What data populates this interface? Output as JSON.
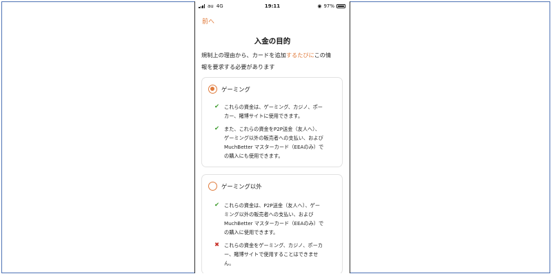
{
  "status": {
    "carrier": "au",
    "network": "4G",
    "time": "19:11",
    "battery": "97%"
  },
  "nav": {
    "back_label": "前へ"
  },
  "title": "入金の目的",
  "intro": {
    "line1_prefix": "規制上の理由から、カードを追加",
    "line1_highlight": "するたびに",
    "line1_suffix": "この情",
    "line2": "報を要求する必要があります"
  },
  "options": [
    {
      "label": "ゲーミング",
      "selected": true,
      "items": [
        {
          "ok": true,
          "lines": [
            "これらの資金は、ゲーミング、カジノ、ポー",
            "カー、賭博サイトに使用できます。"
          ]
        },
        {
          "ok": true,
          "lines": [
            "また、これらの資金をP2P送金（友人へ）、",
            "ゲーミング以外の販売者への支払い、および",
            "MuchBetter マスターカード（EEAのみ）で",
            "の購入にも使用できます。"
          ]
        }
      ]
    },
    {
      "label": "ゲーミング以外",
      "selected": false,
      "items": [
        {
          "ok": true,
          "lines": [
            "これらの資金は、P2P送金（友人へ）、ゲー",
            "ミング以外の販売者への支払い、および",
            "MuchBetter マスターカード（EEAのみ）で",
            "の購入に使用できます。"
          ]
        },
        {
          "ok": false,
          "lines": [
            "これらの資金をゲーミング、カジノ、ポーカ",
            "ー、賭博サイトで使用することはできませ",
            "ん。"
          ]
        }
      ]
    }
  ],
  "icons": {
    "ok": "✔",
    "ng": "✖"
  },
  "colors": {
    "accent": "#e07a3a",
    "ok": "#3a9a2a",
    "ng": "#c8322a",
    "frame": "#4a6fb3"
  }
}
